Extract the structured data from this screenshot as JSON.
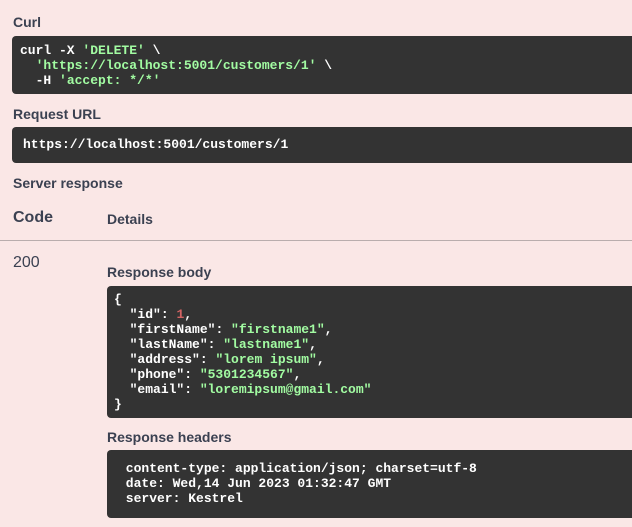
{
  "curl": {
    "label": "Curl",
    "line1_cmd": "curl -X ",
    "line1_method": "'DELETE'",
    "line1_tail": " \\",
    "line2_indent": "  ",
    "line2_url": "'https://localhost:5001/customers/1'",
    "line2_tail": " \\",
    "line3_prefix": "  -H ",
    "line3_header": "'accept: */*'"
  },
  "request_url": {
    "label": "Request URL",
    "value": "https://localhost:5001/customers/1"
  },
  "server_response": {
    "label": "Server response",
    "code_header": "Code",
    "details_header": "Details",
    "code": "200",
    "body_label": "Response body",
    "body": {
      "open": "{",
      "close": "}",
      "fields": [
        {
          "key": "\"id\"",
          "value": "1",
          "type": "num",
          "comma": ","
        },
        {
          "key": "\"firstName\"",
          "value": "\"firstname1\"",
          "type": "str",
          "comma": ","
        },
        {
          "key": "\"lastName\"",
          "value": "\"lastname1\"",
          "type": "str",
          "comma": ","
        },
        {
          "key": "\"address\"",
          "value": "\"lorem ipsum\"",
          "type": "str",
          "comma": ","
        },
        {
          "key": "\"phone\"",
          "value": "\"5301234567\"",
          "type": "str",
          "comma": ","
        },
        {
          "key": "\"email\"",
          "value": "\"loremipsum@gmail.com\"",
          "type": "str",
          "comma": ""
        }
      ]
    },
    "headers_label": "Response headers",
    "headers": [
      " content-type: application/json; charset=utf-8 ",
      " date: Wed,14 Jun 2023 01:32:47 GMT ",
      " server: Kestrel "
    ]
  },
  "colors": {
    "background": "#fae7e6",
    "code_bg": "#333333",
    "string": "#a2fca2",
    "number": "#d36363"
  }
}
